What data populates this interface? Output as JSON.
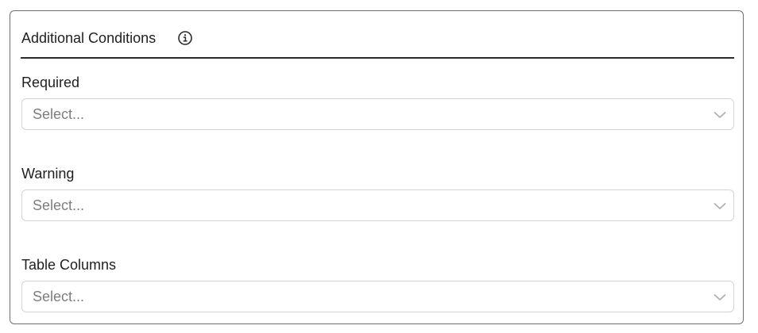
{
  "panel": {
    "title": "Additional Conditions",
    "title_icon": "info-icon"
  },
  "fields": [
    {
      "label": "Required",
      "placeholder": "Select...",
      "icon": "chevron-down-icon"
    },
    {
      "label": "Warning",
      "placeholder": "Select...",
      "icon": "chevron-down-icon"
    },
    {
      "label": "Table Columns",
      "placeholder": "Select...",
      "icon": "chevron-down-icon"
    }
  ],
  "colors": {
    "panel_border": "#6f6f6f",
    "header_rule": "#2a2a2a",
    "select_border": "#d3d3d3",
    "placeholder_text": "#7d7d7d",
    "text": "#1f1f1f"
  }
}
